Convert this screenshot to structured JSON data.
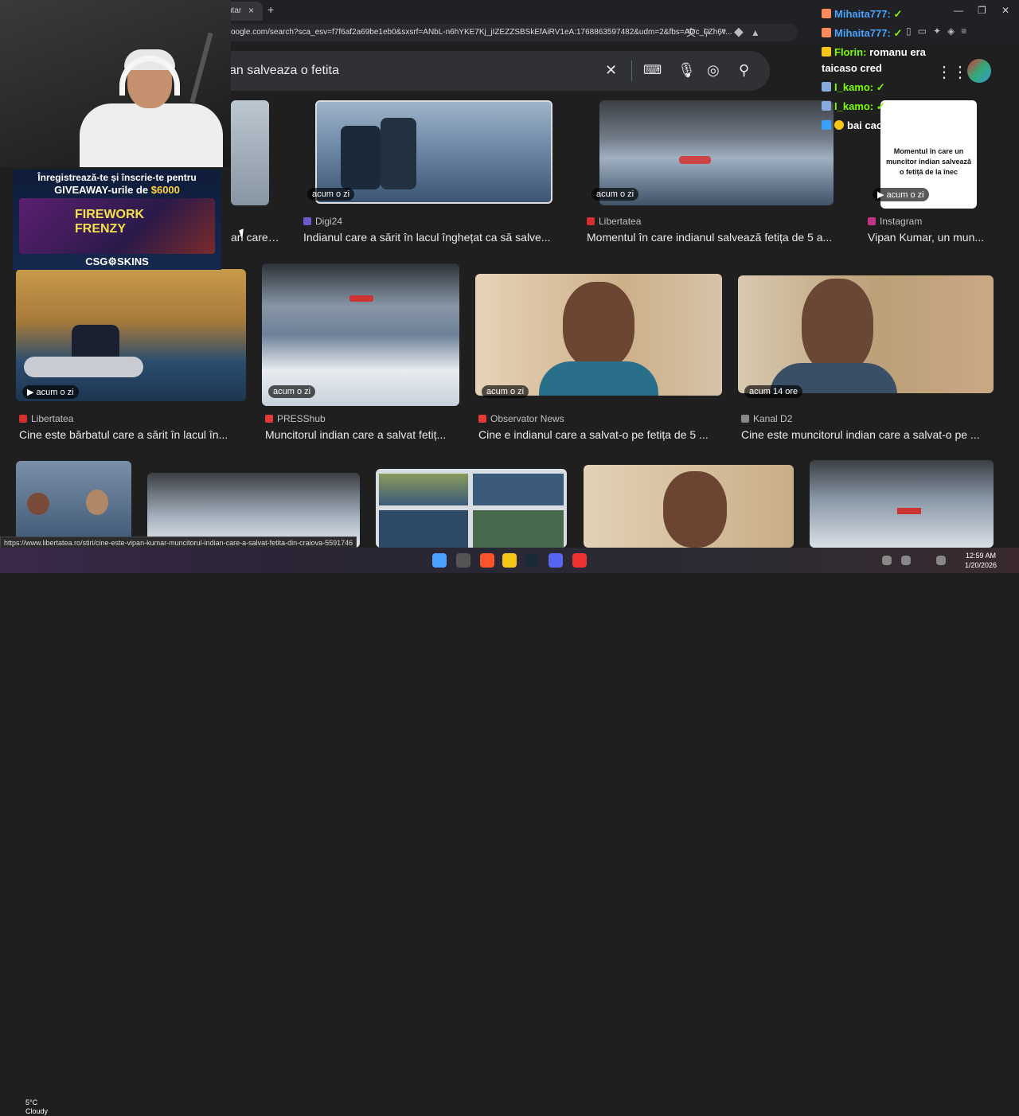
{
  "browser": {
    "tab_title": "utar",
    "tab_close": "×",
    "new_tab": "+",
    "address": "oogle.com/search?sca_esv=f7f6af2a69be1eb0&sxsrf=ANbL-n6hYKE7Kj_jIZEZZSBSkEfAiRV1eA:1768863597482&udm=2&fbs=ADc_l-Zh6v...",
    "window_minimize": "—",
    "window_restore": "❐",
    "window_close": "✕"
  },
  "search": {
    "query": "an salveaza o fetita"
  },
  "results": [
    {
      "badge": "",
      "source": "",
      "title": "an care a ...",
      "source_color": "#444"
    },
    {
      "badge": "acum o zi",
      "source": "Digi24",
      "title": "Indianul care a sărit în lacul înghețat ca să salve...",
      "source_color": "#6a5acd"
    },
    {
      "badge": "acum o zi",
      "source": "Libertatea",
      "title": "Momentul în care indianul salvează fetița de 5 a...",
      "source_color": "#d32f2f"
    },
    {
      "badge": "acum o zi",
      "source": "Instagram",
      "title": "Vipan Kumar, un mun...",
      "source_color": "#c13584",
      "img_text": "Momentul în care un muncitor indian salvează o fetiță de la înec"
    },
    {
      "badge": "acum o zi",
      "source": "Libertatea",
      "title": "Cine este bărbatul care a sărit în lacul în...",
      "source_color": "#d32f2f"
    },
    {
      "badge": "acum o zi",
      "source": "PRESShub",
      "title": "Muncitorul indian care a salvat fetiț...",
      "source_color": "#e53935"
    },
    {
      "badge": "acum o zi",
      "source": "Observator News",
      "title": "Cine e indianul care a salvat-o pe fetița de 5 ...",
      "source_color": "#e53935"
    },
    {
      "badge": "acum 14 ore",
      "source": "Kanal D2",
      "title": "Cine este muncitorul indian care a salvat-o pe ...",
      "source_color": "#888"
    }
  ],
  "overlay": {
    "ad_line1": "Înregistrează-te și înscrie-te pentru",
    "ad_line2_prefix": "GIVEAWAY-urile de ",
    "ad_line2_amount": "$6000",
    "ad_game_title_1": "FIREWORK",
    "ad_game_title_2": "FRENZY",
    "ad_footer": "CSG⚙SKINS"
  },
  "chat": [
    {
      "user": "Mihaita777:",
      "message": "",
      "color": "#4aa3ff"
    },
    {
      "user": "Mihaita777:",
      "message": "",
      "color": "#4aa3ff"
    },
    {
      "user": "Florin:",
      "message": "romanu era",
      "color": "#7cfc00"
    },
    {
      "user": "",
      "message": "taicaso cred",
      "color": "#ffffff"
    },
    {
      "user": "I_kamo:",
      "message": "",
      "color": "#7cfc00"
    },
    {
      "user": "I_kamo:",
      "message": "",
      "color": "#7cfc00"
    },
    {
      "user": "",
      "message": "bai caoe",
      "color": "#ffffff"
    }
  ],
  "status_url": "https://www.libertatea.ro/stiri/cine-este-vipan-kumar-muncitorul-indian-care-a-salvat-fetita-din-craiova-5591746",
  "taskbar": {
    "weather_temp": "5°C",
    "weather_desc": "Cloudy",
    "time": "12:59 AM",
    "date": "1/20/2026"
  }
}
